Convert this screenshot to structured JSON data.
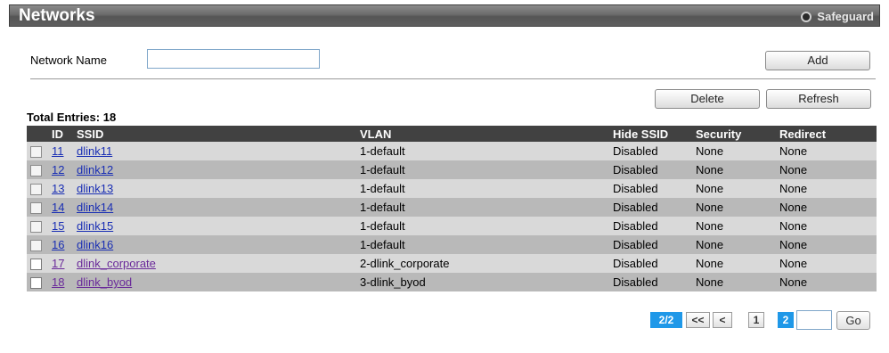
{
  "header": {
    "title": "Networks",
    "safeguard_label": "Safeguard"
  },
  "form": {
    "network_name_label": "Network Name",
    "network_name_value": "",
    "add_label": "Add",
    "delete_label": "Delete",
    "refresh_label": "Refresh"
  },
  "table": {
    "total_label": "Total Entries: 18",
    "columns": [
      "ID",
      "SSID",
      "VLAN",
      "Hide SSID",
      "Security",
      "Redirect"
    ],
    "rows": [
      {
        "id": "11",
        "ssid": "dlink11",
        "vlan": "1-default",
        "hide": "Disabled",
        "security": "None",
        "redirect": "None"
      },
      {
        "id": "12",
        "ssid": "dlink12",
        "vlan": "1-default",
        "hide": "Disabled",
        "security": "None",
        "redirect": "None"
      },
      {
        "id": "13",
        "ssid": "dlink13",
        "vlan": "1-default",
        "hide": "Disabled",
        "security": "None",
        "redirect": "None"
      },
      {
        "id": "14",
        "ssid": "dlink14",
        "vlan": "1-default",
        "hide": "Disabled",
        "security": "None",
        "redirect": "None"
      },
      {
        "id": "15",
        "ssid": "dlink15",
        "vlan": "1-default",
        "hide": "Disabled",
        "security": "None",
        "redirect": "None"
      },
      {
        "id": "16",
        "ssid": "dlink16",
        "vlan": "1-default",
        "hide": "Disabled",
        "security": "None",
        "redirect": "None"
      },
      {
        "id": "17",
        "ssid": "dlink_corporate",
        "vlan": "2-dlink_corporate",
        "hide": "Disabled",
        "security": "None",
        "redirect": "None"
      },
      {
        "id": "18",
        "ssid": "dlink_byod",
        "vlan": "3-dlink_byod",
        "hide": "Disabled",
        "security": "None",
        "redirect": "None"
      }
    ]
  },
  "pager": {
    "info": "2/2",
    "first_label": "<<",
    "prev_label": "<",
    "page1": "1",
    "page2": "2",
    "go_label": "Go"
  },
  "colors": {
    "header_bg": "#414141",
    "row_light": "#d9d9d9",
    "row_dark": "#b9b9b9",
    "pager_active": "#1f98e8"
  }
}
